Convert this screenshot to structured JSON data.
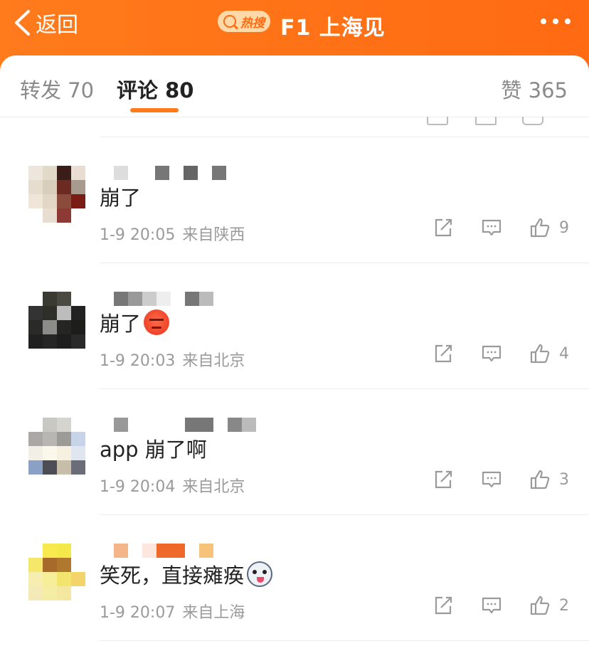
{
  "header": {
    "back_label": "返回",
    "hot_label": "热搜",
    "title": "F1 上海见"
  },
  "tabs": {
    "repost": "转发 70",
    "comment": "评论 80",
    "likes": "赞 365"
  },
  "colors": {
    "brand": "#ff6a12",
    "tab_indicator": "#ff7b1c",
    "meta_text": "#9a9a9a"
  },
  "comments": [
    {
      "text": "崩了",
      "emoji": "",
      "time": "1-9 20:05",
      "source": "来自陕西",
      "likes": "9"
    },
    {
      "text": "崩了",
      "emoji": "angry-face",
      "time": "1-9 20:03",
      "source": "来自北京",
      "likes": "4"
    },
    {
      "text": "app 崩了啊",
      "emoji": "",
      "time": "1-9 20:04",
      "source": "来自北京",
      "likes": "3"
    },
    {
      "text": "笑死，直接瘫痪",
      "emoji": "husky-face",
      "time": "1-9 20:07",
      "source": "来自上海",
      "likes": "2"
    }
  ]
}
